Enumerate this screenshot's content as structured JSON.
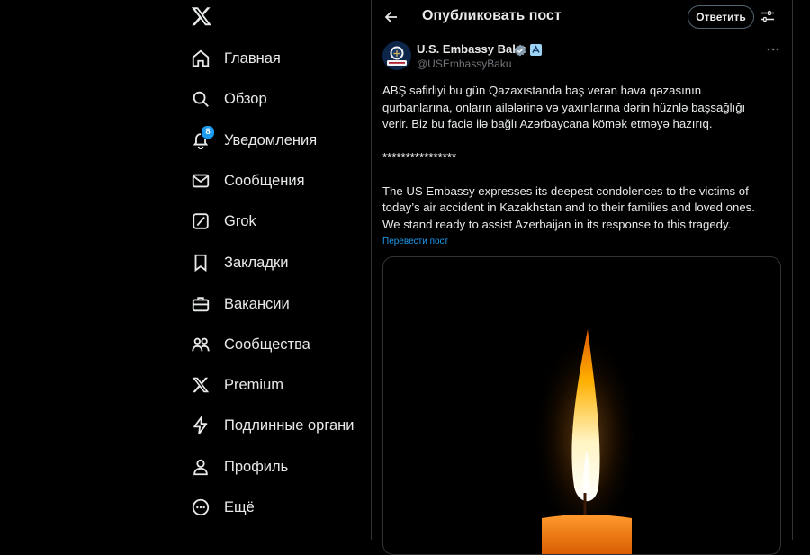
{
  "sidebar": {
    "items": [
      {
        "label": "Главная",
        "icon": "home-icon"
      },
      {
        "label": "Обзор",
        "icon": "search-icon"
      },
      {
        "label": "Уведомления",
        "icon": "bell-icon",
        "badge": "8"
      },
      {
        "label": "Сообщения",
        "icon": "envelope-icon"
      },
      {
        "label": "Grok",
        "icon": "grok-icon"
      },
      {
        "label": "Закладки",
        "icon": "bookmark-icon"
      },
      {
        "label": "Вакансии",
        "icon": "briefcase-icon"
      },
      {
        "label": "Сообщества",
        "icon": "people-icon"
      },
      {
        "label": "Premium",
        "icon": "x-logo-icon"
      },
      {
        "label": "Подлинные органи",
        "icon": "lightning-icon"
      },
      {
        "label": "Профиль",
        "icon": "person-icon"
      },
      {
        "label": "Ещё",
        "icon": "more-circle-icon"
      }
    ]
  },
  "header": {
    "title": "Опубликовать пост",
    "reply_label": "Ответить"
  },
  "post": {
    "author_name": "U.S. Embassy Baku",
    "handle": "@USEmbassyBaku",
    "text_az": "ABŞ səfirliyi bu gün Qazaxıstanda baş verən hava qəzasının qurbanlarına, onların ailələrinə və yaxınlarına dərin hüznlə başsağlığı verir. Biz bu faciə ilə bağlı Azərbaycana kömək etməyə hazırıq.",
    "separator": "****************",
    "text_en": "The US Embassy expresses its deepest condolences to the victims of today’s air accident in Kazakhstan and to their families and loved ones. We stand ready to assist Azerbaijan in its response to this tragedy.",
    "translate_label": "Перевести пост",
    "media_description": "candle-flame-image"
  },
  "colors": {
    "background": "#000000",
    "text": "#e7e9ea",
    "muted": "#71767b",
    "accent": "#1d9bf0",
    "border": "#2f3336"
  }
}
